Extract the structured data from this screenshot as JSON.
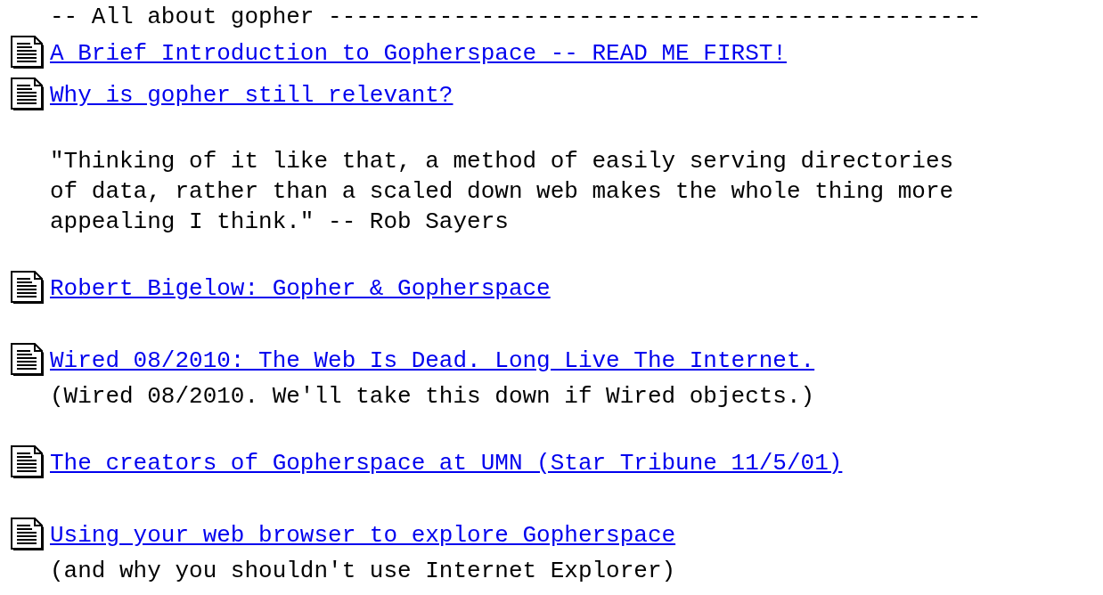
{
  "lines": [
    {
      "kind": "text",
      "text": "-- All about gopher -----------------------------------------------"
    },
    {
      "kind": "link",
      "text": "A Brief Introduction to Gopherspace -- READ ME FIRST!"
    },
    {
      "kind": "link",
      "text": "Why is gopher still relevant?"
    },
    {
      "kind": "blank"
    },
    {
      "kind": "text",
      "text": "\"Thinking of it like that, a method of easily serving directories"
    },
    {
      "kind": "text",
      "text": "of data, rather than a scaled down web makes the whole thing more"
    },
    {
      "kind": "text",
      "text": "appealing I think.\" -- Rob Sayers"
    },
    {
      "kind": "blank"
    },
    {
      "kind": "link",
      "text": "Robert Bigelow: Gopher & Gopherspace"
    },
    {
      "kind": "blank"
    },
    {
      "kind": "link",
      "text": "Wired 08/2010: The Web Is Dead. Long Live The Internet."
    },
    {
      "kind": "text",
      "text": "(Wired 08/2010. We'll take this down if Wired objects.)"
    },
    {
      "kind": "blank"
    },
    {
      "kind": "link",
      "text": "The creators of Gopherspace at UMN (Star Tribune 11/5/01)"
    },
    {
      "kind": "blank"
    },
    {
      "kind": "link",
      "text": "Using your web browser to explore Gopherspace"
    },
    {
      "kind": "text",
      "text": "(and why you shouldn't use Internet Explorer)"
    }
  ]
}
